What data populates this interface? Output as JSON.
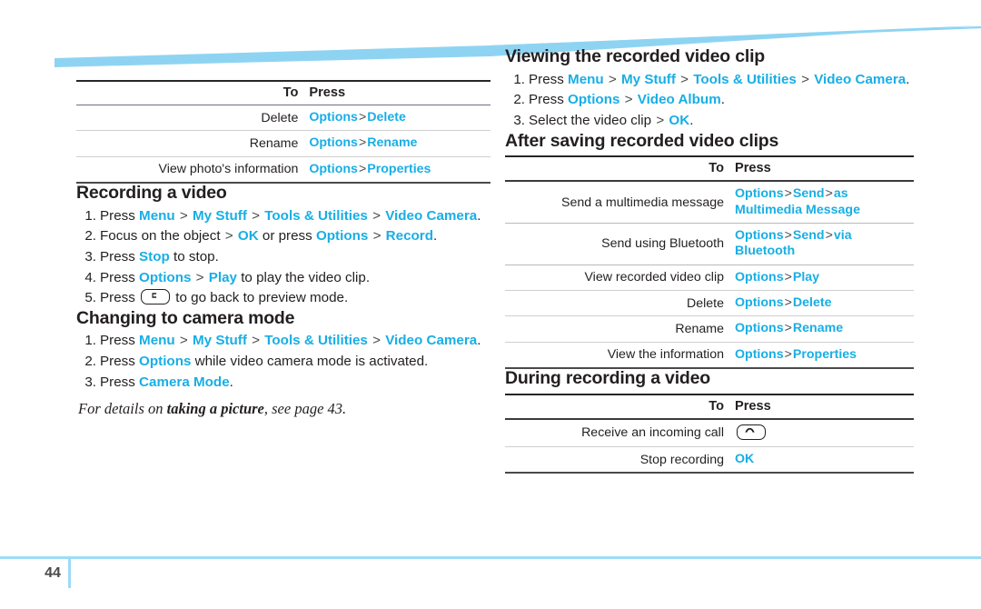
{
  "document": {
    "page_number": "44",
    "accent_color": "#18aee5",
    "band_color": "#8ed4f2",
    "footer_rule_color": "#9bdcf7"
  },
  "left_column": {
    "photo_table": {
      "headers": {
        "to": "To",
        "press": "Press"
      },
      "rows": [
        {
          "to": "Delete",
          "press": [
            "Options",
            ">",
            "Delete"
          ]
        },
        {
          "to": "Rename",
          "press": [
            "Options",
            ">",
            "Rename"
          ]
        },
        {
          "to": "View photo's information",
          "press": [
            "Options",
            ">",
            "Properties"
          ]
        }
      ]
    },
    "recording_section": {
      "title": "Recording a video",
      "steps": [
        {
          "num": "1.",
          "parts": [
            {
              "t": "Press ",
              "k": false
            },
            {
              "t": "Menu",
              "k": true
            },
            {
              "t": " > ",
              "k": "sep"
            },
            {
              "t": "My Stuff",
              "k": true
            },
            {
              "t": " > ",
              "k": "sep"
            },
            {
              "t": "Tools & Utilities",
              "k": true
            },
            {
              "t": " > ",
              "k": "sep"
            },
            {
              "t": "Video Camera",
              "k": true
            },
            {
              "t": ".",
              "k": false
            }
          ]
        },
        {
          "num": "2.",
          "parts": [
            {
              "t": "Focus on the object ",
              "k": false
            },
            {
              "t": "> ",
              "k": "sep"
            },
            {
              "t": "OK",
              "k": true
            },
            {
              "t": " or press ",
              "k": false
            },
            {
              "t": "Options",
              "k": true
            },
            {
              "t": " > ",
              "k": "sep"
            },
            {
              "t": "Record",
              "k": true
            },
            {
              "t": ".",
              "k": false
            }
          ]
        },
        {
          "num": "3.",
          "parts": [
            {
              "t": "Press ",
              "k": false
            },
            {
              "t": "Stop",
              "k": true
            },
            {
              "t": " to stop.",
              "k": false
            }
          ]
        },
        {
          "num": "4.",
          "parts": [
            {
              "t": "Press ",
              "k": false
            },
            {
              "t": "Options",
              "k": true
            },
            {
              "t": " > ",
              "k": "sep"
            },
            {
              "t": "Play",
              "k": true
            },
            {
              "t": " to play the video clip.",
              "k": false
            }
          ]
        },
        {
          "num": "5.",
          "parts": [
            {
              "t": "Press ",
              "k": false
            },
            {
              "t": "clear-key",
              "k": "icon"
            },
            {
              "t": " to go back to preview mode.",
              "k": false
            }
          ]
        }
      ]
    },
    "camera_mode_section": {
      "title": "Changing to camera mode",
      "steps": [
        {
          "num": "1.",
          "parts": [
            {
              "t": "Press ",
              "k": false
            },
            {
              "t": "Menu",
              "k": true
            },
            {
              "t": " > ",
              "k": "sep"
            },
            {
              "t": "My Stuff",
              "k": true
            },
            {
              "t": " > ",
              "k": "sep"
            },
            {
              "t": "Tools & Utilities",
              "k": true
            },
            {
              "t": " > ",
              "k": "sep"
            },
            {
              "t": "Video Camera",
              "k": true
            },
            {
              "t": ".",
              "k": false
            }
          ]
        },
        {
          "num": "2.",
          "parts": [
            {
              "t": "Press ",
              "k": false
            },
            {
              "t": "Options",
              "k": true
            },
            {
              "t": " while video camera mode is activated.",
              "k": false
            }
          ]
        },
        {
          "num": "3.",
          "parts": [
            {
              "t": "Press ",
              "k": false
            },
            {
              "t": "Camera Mode",
              "k": true
            },
            {
              "t": ".",
              "k": false
            }
          ]
        }
      ],
      "footnote": {
        "before": "For details on ",
        "bold": "taking a picture",
        "after": ", see page 43."
      }
    }
  },
  "right_column": {
    "viewing_section": {
      "title": "Viewing the recorded video clip",
      "steps": [
        {
          "num": "1.",
          "parts": [
            {
              "t": "Press ",
              "k": false
            },
            {
              "t": "Menu",
              "k": true
            },
            {
              "t": " > ",
              "k": "sep"
            },
            {
              "t": "My Stuff",
              "k": true
            },
            {
              "t": " > ",
              "k": "sep"
            },
            {
              "t": "Tools & Utilities",
              "k": true
            },
            {
              "t": " > ",
              "k": "sep"
            },
            {
              "t": "Video Camera",
              "k": true
            },
            {
              "t": ".",
              "k": false
            }
          ]
        },
        {
          "num": "2.",
          "parts": [
            {
              "t": "Press ",
              "k": false
            },
            {
              "t": "Options",
              "k": true
            },
            {
              "t": " > ",
              "k": "sep"
            },
            {
              "t": "Video Album",
              "k": true
            },
            {
              "t": ".",
              "k": false
            }
          ]
        },
        {
          "num": "3.",
          "parts": [
            {
              "t": "Select the video clip ",
              "k": false
            },
            {
              "t": "> ",
              "k": "sep"
            },
            {
              "t": "OK",
              "k": true
            },
            {
              "t": ".",
              "k": false
            }
          ]
        }
      ]
    },
    "after_saving_section": {
      "title": "After saving recorded video clips",
      "table": {
        "headers": {
          "to": "To",
          "press": "Press"
        },
        "rows": [
          {
            "to": "Send a multimedia message",
            "press": [
              "Options",
              ">",
              "Send",
              ">",
              "as Multimedia Message"
            ]
          },
          {
            "to": "Send using Bluetooth",
            "press": [
              "Options",
              ">",
              "Send",
              ">",
              "via Bluetooth"
            ]
          },
          {
            "to": "View recorded video clip",
            "press": [
              "Options",
              ">",
              "Play"
            ]
          },
          {
            "to": "Delete",
            "press": [
              "Options",
              ">",
              "Delete"
            ]
          },
          {
            "to": "Rename",
            "press": [
              "Options",
              ">",
              "Rename"
            ]
          },
          {
            "to": "View the information",
            "press": [
              "Options",
              ">",
              "Properties"
            ]
          }
        ]
      }
    },
    "during_recording_section": {
      "title": "During recording a video",
      "table": {
        "headers": {
          "to": "To",
          "press": "Press"
        },
        "rows": [
          {
            "to": "Receive an incoming call",
            "press_icon": "send-key"
          },
          {
            "to": "Stop recording",
            "press": [
              "OK"
            ]
          }
        ]
      }
    }
  }
}
